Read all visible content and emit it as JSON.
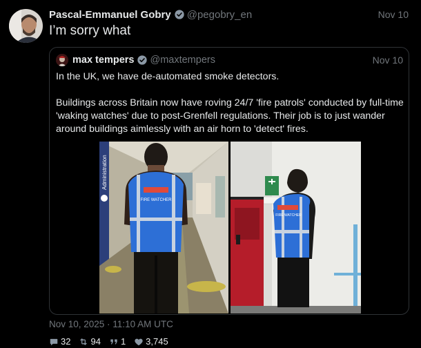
{
  "tweet": {
    "author_name": "Pascal-Emmanuel Gobry",
    "author_handle": "@pegobry_en",
    "date": "Nov 10",
    "text": "I’m sorry what",
    "timestamp": "Nov 10, 2025 · 11:10 AM UTC",
    "stats": {
      "replies": "32",
      "retweets": "94",
      "quotes": "1",
      "likes": "3,745"
    }
  },
  "quoted": {
    "author_name": "max tempers",
    "author_handle": "@maxtempers",
    "date": "Nov 10",
    "paragraph1": "In the UK, we have de-automated smoke detectors.",
    "paragraph2": "Buildings across Britain now have roving 24/7 'fire patrols' conducted by full-time 'waking watches' due to post-Grenfell regulations. Their job is to just wander around buildings aimlessly with an air horn to 'detect' fires."
  },
  "images": {
    "left": {
      "sign_text": "Administration",
      "vest_text": "FIRE WATCHER"
    },
    "right": {
      "vest_text": "FIRE WATCHER"
    }
  },
  "colors": {
    "background": "#000000",
    "text": "#e7e9ea",
    "secondary": "#71767b",
    "verified": "#1d9bf0",
    "border": "#2f3336",
    "vest": "#2d6fd6"
  },
  "icons": {
    "verified": "verified-badge-icon",
    "reply": "reply-icon",
    "retweet": "retweet-icon",
    "quote": "quote-icon",
    "like": "heart-icon"
  }
}
